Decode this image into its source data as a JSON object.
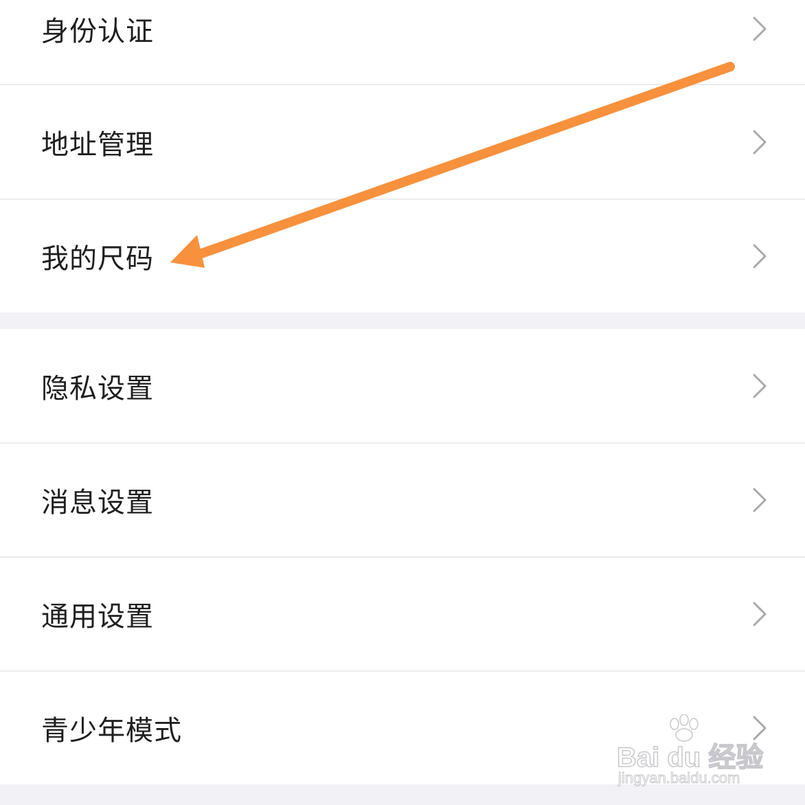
{
  "menu": {
    "items": [
      {
        "label": "身份认证"
      },
      {
        "label": "地址管理"
      },
      {
        "label": "我的尺码"
      },
      {
        "label": "隐私设置"
      },
      {
        "label": "消息设置"
      },
      {
        "label": "通用设置"
      },
      {
        "label": "青少年模式"
      }
    ]
  },
  "annotation": {
    "color": "#f7913d",
    "points_to": "我的尺码"
  },
  "watermark": {
    "brand": "Bai du 经验",
    "url": "jingyan.baidu.com"
  },
  "icons": {
    "chevron": "chevron-right-icon",
    "arrow": "arrow-icon",
    "paw": "paw-icon"
  }
}
